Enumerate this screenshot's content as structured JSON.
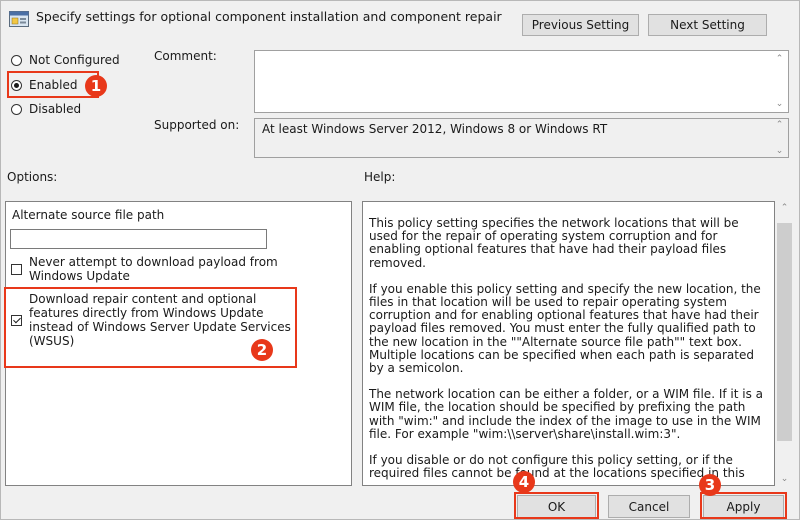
{
  "window": {
    "title": "Specify settings for optional component installation and component repair",
    "icon": "policy-settings-icon"
  },
  "nav": {
    "previous_label": "Previous Setting",
    "next_label": "Next Setting"
  },
  "state": {
    "options": [
      {
        "label": "Not Configured",
        "checked": false
      },
      {
        "label": "Enabled",
        "checked": true
      },
      {
        "label": "Disabled",
        "checked": false
      }
    ]
  },
  "comment": {
    "label": "Comment:",
    "value": ""
  },
  "supported": {
    "label": "Supported on:",
    "value": "At least Windows Server 2012, Windows 8 or Windows RT"
  },
  "options_panel": {
    "heading": "Options:",
    "path_label": "Alternate source file path",
    "path_value": "",
    "never_download": {
      "label": "Never attempt to download payload from Windows Update",
      "checked": false
    },
    "direct_download": {
      "label": "Download repair content and optional features directly from Windows Update instead of Windows Server Update Services (WSUS)",
      "checked": true
    }
  },
  "help_panel": {
    "heading": "Help:",
    "paragraphs": [
      "This policy setting specifies the network locations that will be used for the repair of operating system corruption and for enabling optional features that have had their payload files removed.",
      "If you enable this policy setting and specify the new location, the files in that location will be used to repair operating system corruption and for enabling optional features that have had their payload files removed. You must enter the fully qualified path to the new location in the \"\"Alternate source file path\"\" text box. Multiple locations can be specified when each path is separated by a semicolon.",
      "The network location can be either a folder, or a WIM file. If it is a WIM file, the location should be specified by prefixing the path with \"wim:\" and include the index of the image to use in the WIM file. For example \"wim:\\\\server\\share\\install.wim:3\".",
      "If you disable or do not configure this policy setting, or if the required files cannot be found at the locations specified in this"
    ]
  },
  "footer": {
    "ok_label": "OK",
    "cancel_label": "Cancel",
    "apply_label": "Apply"
  },
  "annotations": {
    "step1": "1",
    "step2": "2",
    "step3": "3",
    "step4": "4",
    "color": "#e8381a"
  }
}
